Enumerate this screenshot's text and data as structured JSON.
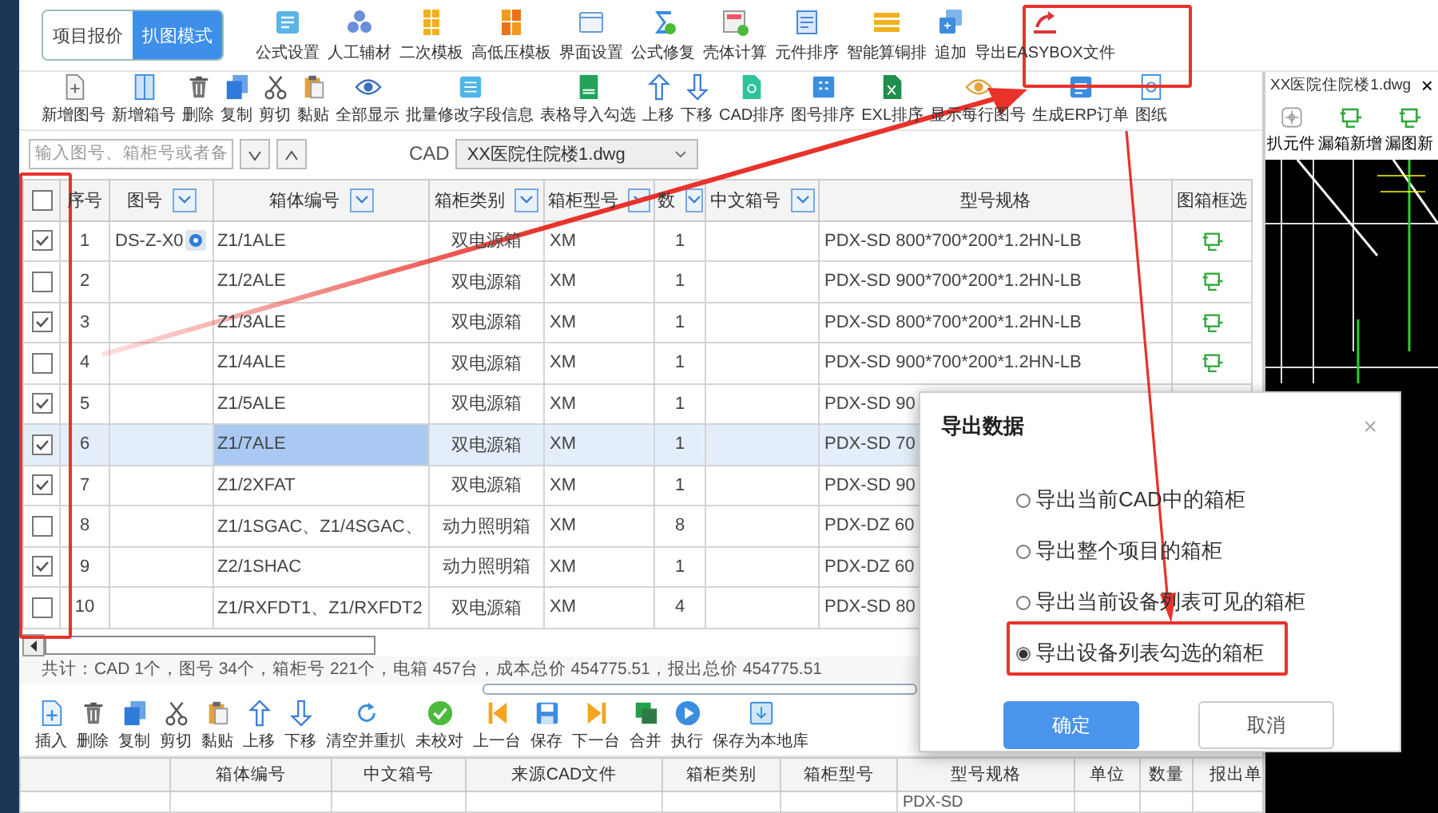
{
  "mode_tabs": [
    {
      "label": "项目报价",
      "selected": false
    },
    {
      "label": "扒图模式",
      "selected": true
    }
  ],
  "ribbon": [
    {
      "label": "公式设置"
    },
    {
      "label": "人工辅材"
    },
    {
      "label": "二次模板"
    },
    {
      "label": "高低压模板"
    },
    {
      "label": "界面设置"
    },
    {
      "label": "公式修复"
    },
    {
      "label": "壳体计算"
    },
    {
      "label": "元件排序"
    },
    {
      "label": "智能算铜排"
    },
    {
      "label": "追加"
    },
    {
      "label": "导出EASYBOX文件"
    }
  ],
  "toolbar": [
    {
      "label": "新增图号"
    },
    {
      "label": "新增箱号"
    },
    {
      "label": "删除"
    },
    {
      "label": "复制"
    },
    {
      "label": "剪切"
    },
    {
      "label": "黏贴"
    },
    {
      "label": "全部显示"
    },
    {
      "label": "批量修改字段信息"
    },
    {
      "label": "表格导入勾选"
    },
    {
      "label": "上移"
    },
    {
      "label": "下移"
    },
    {
      "label": "CAD排序"
    },
    {
      "label": "图号排序"
    },
    {
      "label": "EXL排序"
    },
    {
      "label": "显示每行图号"
    },
    {
      "label": "生成ERP订单"
    },
    {
      "label": "图纸"
    }
  ],
  "search": {
    "placeholder": "输入图号、箱柜号或者备",
    "cad_label": "CAD",
    "cad_file": "XX医院住院楼1.dwg"
  },
  "table": {
    "header_checked": false,
    "columns": [
      {
        "label": "序号",
        "kind": "seq",
        "filter": false
      },
      {
        "label": "图号",
        "kind": "drawing_no",
        "filter": true
      },
      {
        "label": "箱体编号",
        "kind": "box_no",
        "filter": true
      },
      {
        "label": "箱柜类别",
        "kind": "category",
        "filter": true
      },
      {
        "label": "箱柜型号",
        "kind": "model",
        "filter": true
      },
      {
        "label": "数",
        "kind": "count",
        "filter": true
      },
      {
        "label": "中文箱号",
        "kind": "chinese_no",
        "filter": true
      },
      {
        "label": "型号规格",
        "kind": "spec",
        "filter": false
      },
      {
        "label": "图箱框选",
        "kind": "frame",
        "filter": false
      }
    ],
    "rows": [
      {
        "checked": true,
        "selected": false,
        "seq": "1",
        "drawing_no": "DS-Z-X0",
        "drawing_link": true,
        "box_no": "Z1/1ALE",
        "category": "双电源箱",
        "model": "XM",
        "count": "1",
        "spec": "PDX-SD 800*700*200*1.2HN-LB",
        "frame_icon": true
      },
      {
        "checked": false,
        "selected": false,
        "seq": "2",
        "drawing_link": false,
        "box_no": "Z1/2ALE",
        "category": "双电源箱",
        "model": "XM",
        "count": "1",
        "spec": "PDX-SD 900*700*200*1.2HN-LB",
        "frame_icon": true
      },
      {
        "checked": true,
        "selected": false,
        "seq": "3",
        "drawing_link": false,
        "box_no": "Z1/3ALE",
        "category": "双电源箱",
        "model": "XM",
        "count": "1",
        "spec": "PDX-SD 800*700*200*1.2HN-LB",
        "frame_icon": true
      },
      {
        "checked": false,
        "selected": false,
        "seq": "4",
        "drawing_link": false,
        "box_no": "Z1/4ALE",
        "category": "双电源箱",
        "model": "XM",
        "count": "1",
        "spec": "PDX-SD 900*700*200*1.2HN-LB",
        "frame_icon": true
      },
      {
        "checked": true,
        "selected": false,
        "seq": "5",
        "drawing_link": false,
        "box_no": "Z1/5ALE",
        "category": "双电源箱",
        "model": "XM",
        "count": "1",
        "spec": "PDX-SD 90",
        "frame_icon": false
      },
      {
        "checked": true,
        "selected": true,
        "seq": "6",
        "drawing_link": false,
        "box_no": "Z1/7ALE",
        "category": "双电源箱",
        "model": "XM",
        "count": "1",
        "spec": "PDX-SD 70",
        "frame_icon": false
      },
      {
        "checked": true,
        "selected": false,
        "seq": "7",
        "drawing_link": false,
        "box_no": "Z1/2XFAT",
        "category": "双电源箱",
        "model": "XM",
        "count": "1",
        "spec": "PDX-SD 90",
        "frame_icon": false
      },
      {
        "checked": false,
        "selected": false,
        "seq": "8",
        "drawing_link": false,
        "box_no": "Z1/1SGAC、Z1/4SGAC、",
        "category": "动力照明箱",
        "model": "XM",
        "count": "8",
        "spec": "PDX-DZ 60",
        "frame_icon": false
      },
      {
        "checked": true,
        "selected": false,
        "seq": "9",
        "drawing_link": false,
        "box_no": "Z2/1SHAC",
        "category": "动力照明箱",
        "model": "XM",
        "count": "1",
        "spec": "PDX-DZ 60",
        "frame_icon": false
      },
      {
        "checked": false,
        "selected": false,
        "seq": "10",
        "drawing_link": false,
        "box_no": "Z1/RXFDT1、Z1/RXFDT2",
        "category": "双电源箱",
        "model": "XM",
        "count": "4",
        "spec": "PDX-SD 80",
        "frame_icon": false
      }
    ]
  },
  "status_bar": "共计：CAD 1个，图号 34个，箱柜号 221个，电箱 457台，成本总价 454775.51，报出总价 454775.51",
  "bottom_toolbar": [
    {
      "label": "插入"
    },
    {
      "label": "删除"
    },
    {
      "label": "复制"
    },
    {
      "label": "剪切"
    },
    {
      "label": "黏贴"
    },
    {
      "label": "上移"
    },
    {
      "label": "下移"
    },
    {
      "label": "清空并重扒"
    },
    {
      "label": "未校对"
    },
    {
      "label": "上一台"
    },
    {
      "label": "保存"
    },
    {
      "label": "下一台"
    },
    {
      "label": "合并"
    },
    {
      "label": "执行"
    },
    {
      "label": "保存为本地库"
    }
  ],
  "bottom_table": {
    "columns": [
      {
        "label": "箱体编号",
        "kind": "box_no"
      },
      {
        "label": "中文箱号",
        "kind": "chinese_no"
      },
      {
        "label": "来源CAD文件",
        "kind": "source"
      },
      {
        "label": "箱柜类别",
        "kind": "category"
      },
      {
        "label": "箱柜型号",
        "kind": "model"
      },
      {
        "label": "型号规格",
        "kind": "spec"
      },
      {
        "label": "单位",
        "kind": "unit"
      },
      {
        "label": "数量",
        "kind": "qty"
      },
      {
        "label": "报出单",
        "kind": "price"
      }
    ],
    "rows": [
      {
        "spec": "PDX-SD"
      }
    ]
  },
  "cad_panel": {
    "title": "XX医院住院楼1.dwg",
    "close": "×",
    "tools": [
      {
        "label": "扒元件"
      },
      {
        "label": "漏箱新增"
      },
      {
        "label": "漏图新"
      }
    ]
  },
  "dialog": {
    "title": "导出数据",
    "close": "×",
    "options": [
      {
        "label": "导出当前CAD中的箱柜",
        "selected": false
      },
      {
        "label": "导出整个项目的箱柜",
        "selected": false
      },
      {
        "label": "导出当前设备列表可见的箱柜",
        "selected": false
      },
      {
        "label": "导出设备列表勾选的箱柜",
        "selected": true
      }
    ],
    "buttons": [
      {
        "label": "确定",
        "kind": "primary"
      },
      {
        "label": "取消",
        "kind": "secondary"
      }
    ]
  }
}
